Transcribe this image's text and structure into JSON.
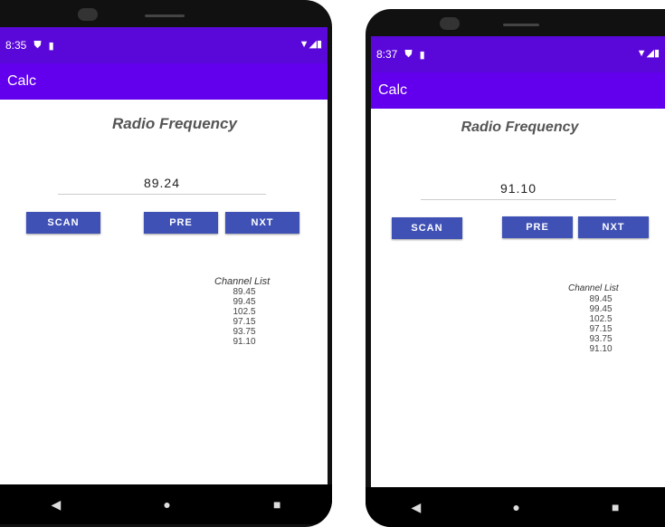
{
  "screens": [
    {
      "status_time": "8:35",
      "app_title": "Calc",
      "heading": "Radio Frequency",
      "frequency_value": "89.24",
      "buttons": {
        "scan": "SCAN",
        "pre": "PRE",
        "nxt": "NXT"
      },
      "channel_header": "Channel List",
      "channels": [
        "89.45",
        "99.45",
        "102.5",
        "97.15",
        "93.75",
        "91.10"
      ]
    },
    {
      "status_time": "8:37",
      "app_title": "Calc",
      "heading": "Radio Frequency",
      "frequency_value": "91.10",
      "buttons": {
        "scan": "SCAN",
        "pre": "PRE",
        "nxt": "NXT"
      },
      "channel_header": "Channel List",
      "channels": [
        "89.45",
        "99.45",
        "102.5",
        "97.15",
        "93.75",
        "91.10"
      ]
    }
  ],
  "icons": {
    "status": [
      "shield-icon",
      "sim-card-icon",
      "wifi-icon",
      "signal-icon",
      "battery-icon"
    ],
    "nav": [
      "back-icon",
      "home-icon",
      "recents-icon"
    ]
  },
  "colors": {
    "status_bar": "#5a08d9",
    "app_bar": "#6200ee",
    "button": "#3f51b5"
  }
}
